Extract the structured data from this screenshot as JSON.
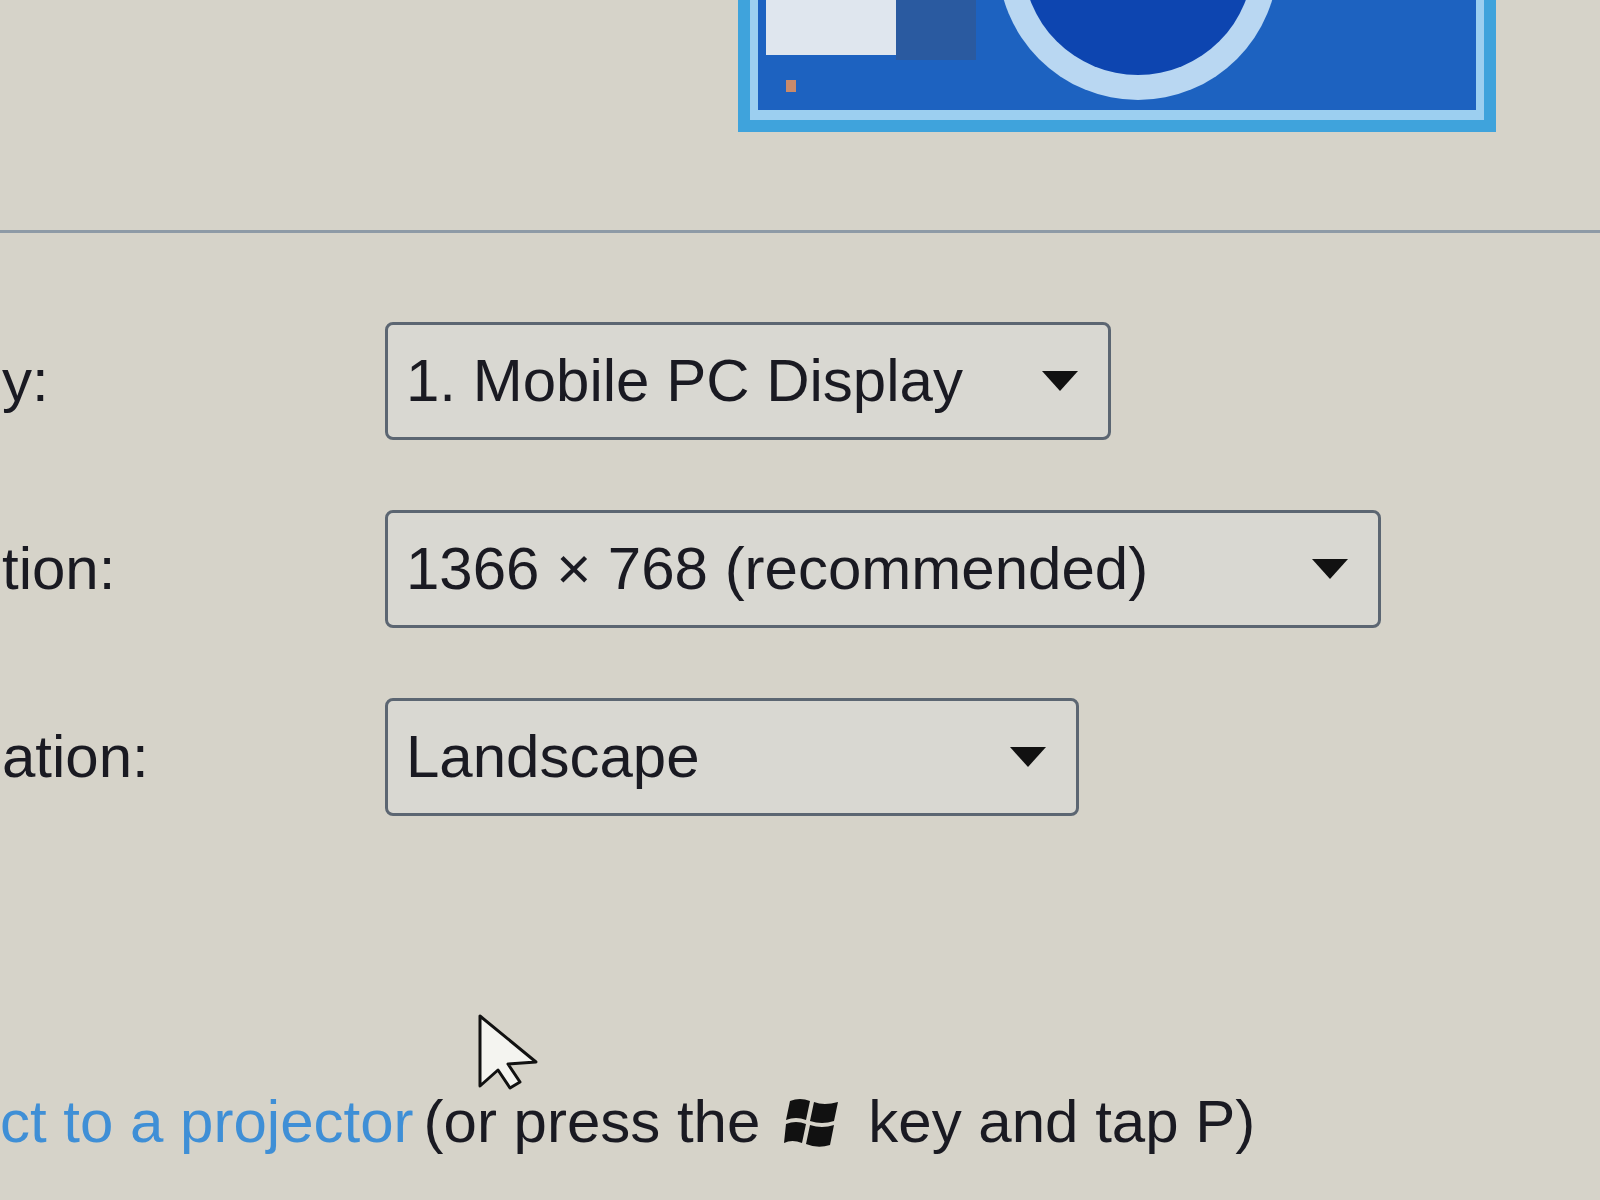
{
  "settings": [
    {
      "label": "y:",
      "value": "1. Mobile PC Display"
    },
    {
      "label": "tion:",
      "value": "1366 × 768 (recommended)"
    },
    {
      "label": "ation:",
      "value": "Landscape"
    }
  ],
  "projector_hint": {
    "link": "ct to a projector",
    "before_key": "(or press the",
    "after_key": "key and tap P)"
  }
}
